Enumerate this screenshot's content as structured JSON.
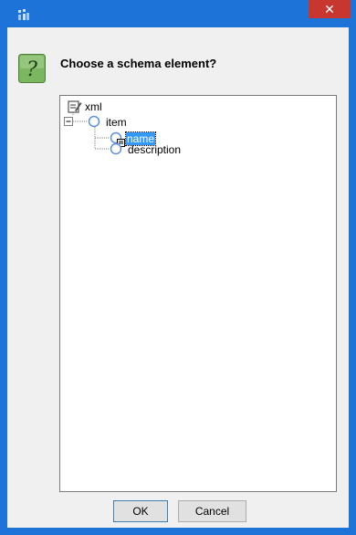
{
  "window": {
    "title": "",
    "close_glyph": "✕",
    "accent": "#1e73d8",
    "close_color": "#c7372f"
  },
  "dialog": {
    "prompt": "Choose a schema element?",
    "icon": "question-icon"
  },
  "tree": {
    "root": {
      "label": "xml",
      "icon": "document-edit-icon"
    },
    "item": {
      "label": "item",
      "icon": "element-circle-icon",
      "expanded": true
    },
    "children": [
      {
        "label": "name",
        "icon": "element-circle-icon",
        "selected": true
      },
      {
        "label": "description",
        "icon": "element-circle-icon",
        "selected": false
      }
    ]
  },
  "buttons": {
    "ok": "OK",
    "cancel": "Cancel"
  }
}
